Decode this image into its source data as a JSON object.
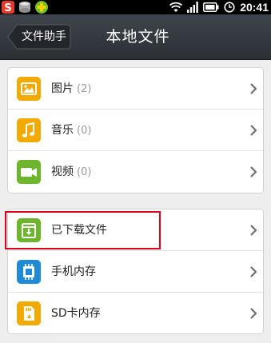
{
  "status_bar": {
    "time": "20:41",
    "icons": [
      "sougou-icon",
      "storage-icon",
      "security-plus-icon",
      "wifi-icon",
      "signal-icon",
      "battery-icon",
      "alarm-icon"
    ]
  },
  "header": {
    "back_label": "文件助手",
    "title": "本地文件"
  },
  "groups": [
    {
      "items": [
        {
          "label": "图片",
          "count": "(2)",
          "icon": "image-icon",
          "color": "#f2a900"
        },
        {
          "label": "音乐",
          "count": "(0)",
          "icon": "music-icon",
          "color": "#f2a900"
        },
        {
          "label": "视频",
          "count": "(0)",
          "icon": "video-icon",
          "color": "#6cb52c"
        }
      ]
    },
    {
      "items": [
        {
          "label": "已下载文件",
          "icon": "download-icon",
          "color": "#6cb52c"
        },
        {
          "label": "手机内存",
          "icon": "memory-chip-icon",
          "color": "#1f8ad8"
        },
        {
          "label": "SD卡内存",
          "icon": "sd-card-icon",
          "color": "#f2a900"
        }
      ]
    }
  ],
  "colors": {
    "header_bg": "#363b41",
    "page_bg": "#eeeeee",
    "highlight": "#e0001b"
  }
}
